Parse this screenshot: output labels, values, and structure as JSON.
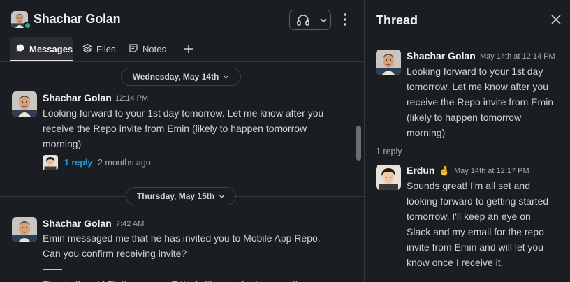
{
  "header": {
    "title": "Shachar Golan"
  },
  "tabs": [
    {
      "label": "Messages",
      "icon": "chat-bubble-icon"
    },
    {
      "label": "Files",
      "icon": "layers-icon"
    },
    {
      "label": "Notes",
      "icon": "note-icon"
    }
  ],
  "dates": {
    "first": "Wednesday, May 14th",
    "second": "Thursday, May 15th"
  },
  "messages": [
    {
      "sender": "Shachar Golan",
      "time": "12:14 PM",
      "lines": [
        "Looking forward to your 1st day tomorrow. Let me know after you",
        "receive the Repo invite from Emin (likely to happen tomorrow",
        "morning)"
      ],
      "reply_count": "1 reply",
      "reply_ago": "2 months ago"
    },
    {
      "sender": "Shachar Golan",
      "time": "7:42 AM",
      "lines": [
        "Emin messaged me that he has invited you to Mobile App Repo.",
        "Can you confirm receiving invite?",
        "——",
        "Thank, there'd Flutter app on GitHub (this is what's our path"
      ]
    }
  ],
  "thread": {
    "title": "Thread",
    "parent": {
      "sender": "Shachar Golan",
      "time": "May 14th at 12:14 PM",
      "lines": [
        "Looking forward to your 1st day",
        "tomorrow. Let me know after you",
        "receive the Repo invite from Emin",
        "(likely to happen tomorrow",
        "morning)"
      ]
    },
    "reply_separator": "1 reply",
    "reply": {
      "sender": "Erdun",
      "emoji": "🤞",
      "time": "May 14th at 12:17 PM",
      "lines": [
        "Sounds great! I'm all set and",
        "looking forward to getting started",
        "tomorrow. I'll keep an eye on",
        "Slack and my email for the repo",
        "invite from Emin and will let you",
        "know once I receive it."
      ]
    }
  },
  "colors": {
    "background": "#1a1d21",
    "link": "#1d9bd1",
    "presence": "#2bac76"
  }
}
